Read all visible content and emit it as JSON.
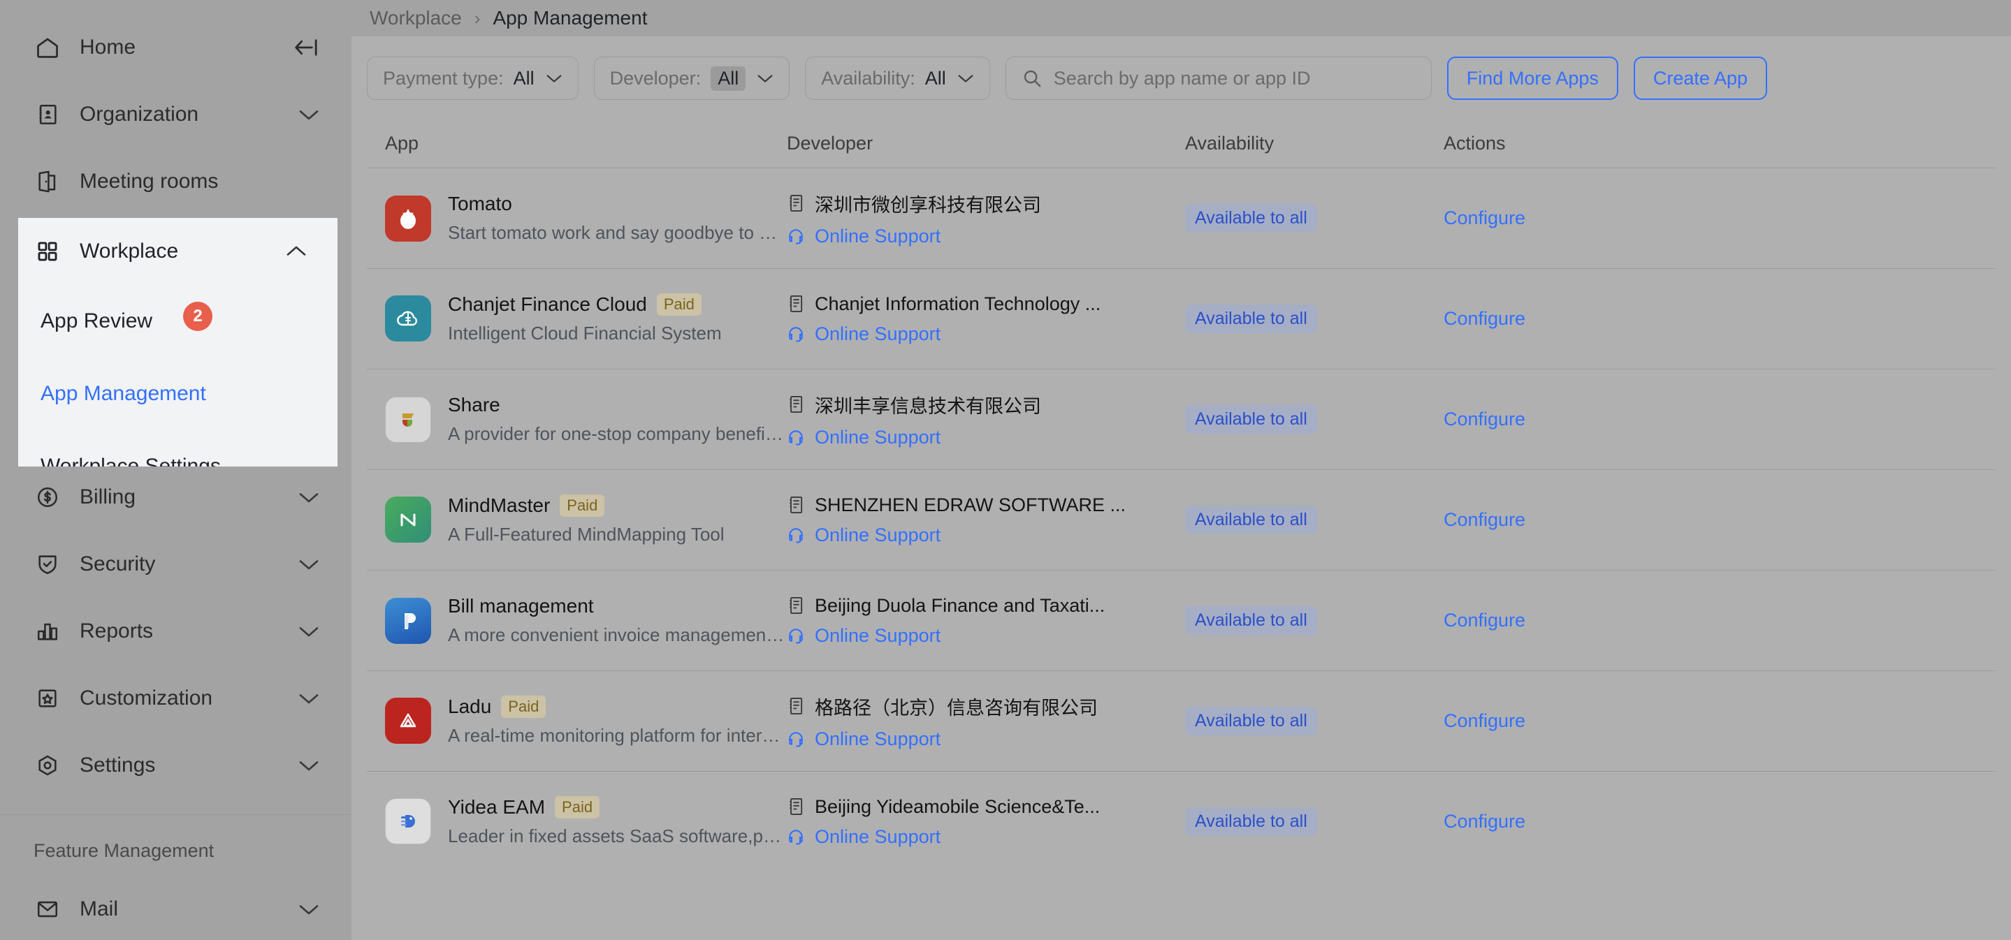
{
  "sidebar": {
    "collapse_icon": "collapse-left-icon",
    "items": [
      {
        "label": "Home",
        "icon": "home-icon",
        "chevron": ""
      },
      {
        "label": "Organization",
        "icon": "contacts-icon",
        "chevron": "down"
      },
      {
        "label": "Meeting rooms",
        "icon": "meeting-room-icon",
        "chevron": ""
      },
      {
        "label": "Billing",
        "icon": "dollar-circle-icon",
        "chevron": "down"
      },
      {
        "label": "Security",
        "icon": "shield-check-icon",
        "chevron": "down"
      },
      {
        "label": "Reports",
        "icon": "bar-chart-icon",
        "chevron": "down"
      },
      {
        "label": "Customization",
        "icon": "star-frame-icon",
        "chevron": "down"
      },
      {
        "label": "Settings",
        "icon": "gear-hex-icon",
        "chevron": "down"
      }
    ],
    "section_title": "Feature Management",
    "feature_items": [
      {
        "label": "Mail",
        "icon": "mail-icon",
        "chevron": "down"
      }
    ],
    "workplace": {
      "label": "Workplace",
      "icon": "grid-apps-icon",
      "chevron": "up",
      "sub_items": [
        {
          "label": "App Review",
          "badge": "2",
          "active": false
        },
        {
          "label": "App Management",
          "badge": "",
          "active": true
        },
        {
          "label": "Workplace Settings",
          "badge": "",
          "active": false
        }
      ]
    }
  },
  "breadcrumb": {
    "parent": "Workplace",
    "separator": "›",
    "current": "App Management"
  },
  "toolbar": {
    "filters": [
      {
        "label": "Payment type:",
        "value": "All",
        "selected": false
      },
      {
        "label": "Developer:",
        "value": "All",
        "selected": true
      },
      {
        "label": "Availability:",
        "value": "All",
        "selected": false
      }
    ],
    "search_placeholder": "Search by app name or app ID",
    "search_value": "",
    "find_more_apps_label": "Find More Apps",
    "create_app_label": "Create App"
  },
  "table": {
    "columns": [
      "App",
      "Developer",
      "Availability",
      "Actions"
    ],
    "support_label": "Online Support",
    "availability_label": "Available to all",
    "configure_label": "Configure",
    "paid_label": "Paid",
    "rows": [
      {
        "name": "Tomato",
        "paid": false,
        "desc": "Start tomato work and say goodbye to procrastination",
        "developer": "深圳市微创享科技有限公司",
        "availability": "Available to all",
        "action": "Configure",
        "icon": {
          "name": "tomato-app-icon",
          "bg": "#c0392b",
          "fg": "#ffffff"
        }
      },
      {
        "name": "Chanjet Finance Cloud",
        "paid": true,
        "desc": "Intelligent Cloud Financial System",
        "developer": "Chanjet Information Technology ...",
        "availability": "Available to all",
        "action": "Configure",
        "icon": {
          "name": "chanjet-cloud-app-icon",
          "bg": "#2b8a9e",
          "fg": "#ffffff"
        }
      },
      {
        "name": "Share",
        "paid": false,
        "desc": "A provider for one-stop company benefit solutions",
        "developer": "深圳丰享信息技术有限公司",
        "availability": "Available to all",
        "action": "Configure",
        "icon": {
          "name": "share-app-icon",
          "bg": "#d6d6d6",
          "fg": "#c79b2b"
        }
      },
      {
        "name": "MindMaster",
        "paid": true,
        "desc": "A Full-Featured MindMapping Tool",
        "developer": "SHENZHEN EDRAW SOFTWARE ...",
        "availability": "Available to all",
        "action": "Configure",
        "icon": {
          "name": "mindmaster-app-icon",
          "bg": "#3a9e5c",
          "fg": "#ffffff"
        }
      },
      {
        "name": "Bill management",
        "paid": false,
        "desc": "A more convenient invoice management tool for reimbursement...",
        "developer": "Beijing Duola Finance and Taxati...",
        "availability": "Available to all",
        "action": "Configure",
        "icon": {
          "name": "bill-management-app-icon",
          "bg": "#2b6fc4",
          "fg": "#ffffff"
        }
      },
      {
        "name": "Ladu",
        "paid": true,
        "desc": "A real-time monitoring platform for internet public opinions",
        "developer": "格路径（北京）信息咨询有限公司",
        "availability": "Available to all",
        "action": "Configure",
        "icon": {
          "name": "ladu-app-icon",
          "bg": "#bc2420",
          "fg": "#ffffff"
        }
      },
      {
        "name": "Yidea EAM",
        "paid": true,
        "desc": "Leader in fixed assets SaaS software,providing fixed asset life c...",
        "developer": "Beijing Yideamobile Science&Te...",
        "availability": "Available to all",
        "action": "Configure",
        "icon": {
          "name": "yidea-eam-app-icon",
          "bg": "#d9d9d9",
          "fg": "#3b6fd4"
        }
      }
    ]
  },
  "colors": {
    "accent": "#3370ff",
    "badge_red": "#e8604c",
    "paid_badge_bg": "#ccc2a5",
    "paid_badge_fg": "#7a6320",
    "availability_bg": "#a6aec6",
    "availability_fg": "#2b50c8"
  }
}
